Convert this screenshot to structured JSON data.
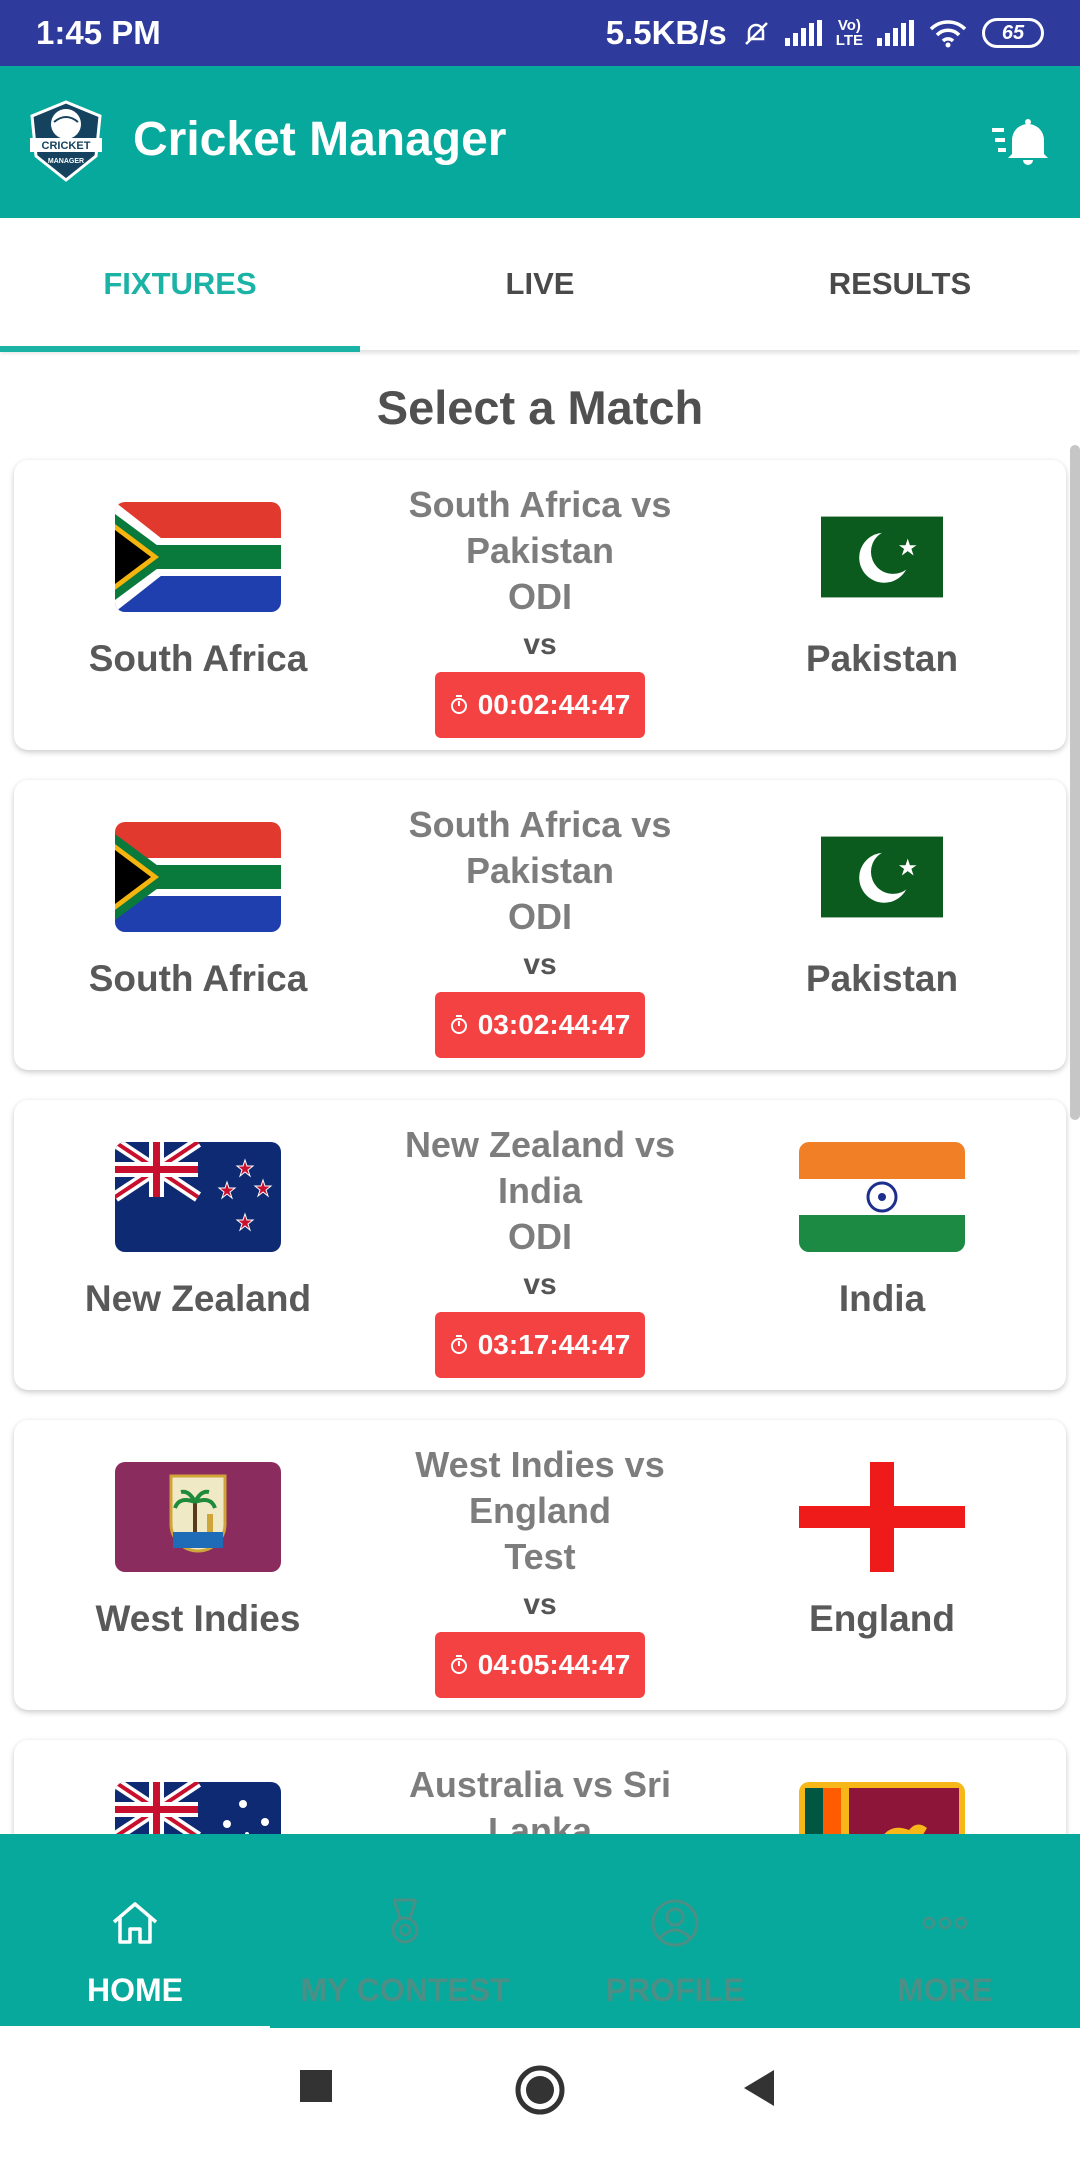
{
  "status_bar": {
    "time": "1:45 PM",
    "net_speed": "5.5KB/s",
    "lte_top": "Vo)",
    "lte_bottom": "LTE",
    "battery": "65"
  },
  "app_bar": {
    "title": "Cricket Manager",
    "logo_icon": "cricket-manager-logo-icon",
    "logo_text": "CRICKET MANAGER",
    "notification_icon": "notification-bell-icon"
  },
  "tabs": [
    {
      "label": "FIXTURES",
      "active": true
    },
    {
      "label": "LIVE",
      "active": false
    },
    {
      "label": "RESULTS",
      "active": false
    }
  ],
  "section_title": "Select a Match",
  "matches": [
    {
      "team_a": "South Africa",
      "team_b": "Pakistan",
      "title": "South Africa  vs Pakistan",
      "format": "ODI",
      "vs": "vs",
      "countdown": "00:02:44:47",
      "flag_a": "south-africa-flag",
      "flag_b": "pakistan-flag"
    },
    {
      "team_a": "South Africa",
      "team_b": "Pakistan",
      "title": "South Africa  vs Pakistan",
      "format": "ODI",
      "vs": "vs",
      "countdown": "03:02:44:47",
      "flag_a": "south-africa-flag",
      "flag_b": "pakistan-flag"
    },
    {
      "team_a": "New Zealand",
      "team_b": "India",
      "title": "New Zealand  vs India",
      "format": "ODI",
      "vs": "vs",
      "countdown": "03:17:44:47",
      "flag_a": "new-zealand-flag",
      "flag_b": "india-flag"
    },
    {
      "team_a": "West Indies",
      "team_b": "England",
      "title": "West Indies  vs England",
      "format": "Test",
      "vs": "vs",
      "countdown": "04:05:44:47",
      "flag_a": "west-indies-flag",
      "flag_b": "england-flag"
    },
    {
      "team_a": "",
      "team_b": "",
      "title": "Australia  vs  Sri Lanka",
      "format": "",
      "vs": "",
      "countdown": "",
      "flag_a": "australia-flag",
      "flag_b": "sri-lanka-flag"
    }
  ],
  "bottom_nav": [
    {
      "label": "HOME",
      "icon": "home-icon",
      "active": true
    },
    {
      "label": "MY CONTEST",
      "icon": "trophy-medal-icon",
      "active": false
    },
    {
      "label": "PROFILE",
      "icon": "profile-icon",
      "active": false
    },
    {
      "label": "MORE",
      "icon": "more-dots-icon",
      "active": false
    }
  ],
  "colors": {
    "status_bar": "#2f3b9c",
    "primary": "#06a99b",
    "accent": "#1bb3a6",
    "timer": "#f44242"
  }
}
